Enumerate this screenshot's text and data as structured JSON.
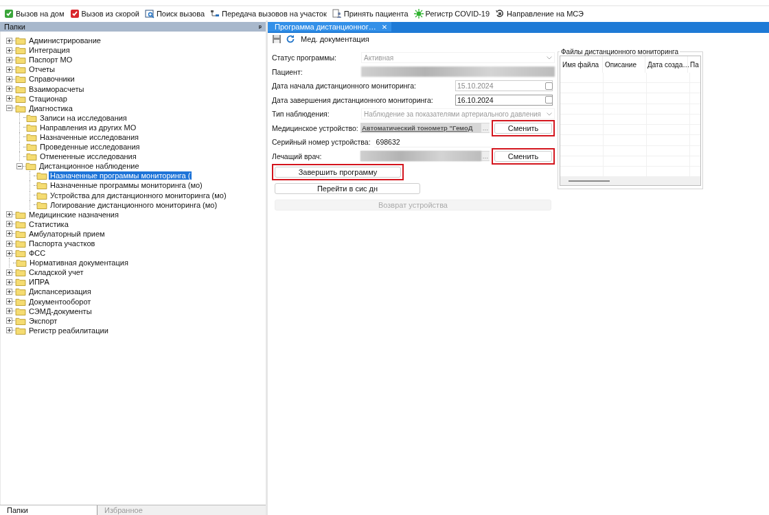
{
  "top_toolbar": [
    {
      "label": "Вызов на дом",
      "kind": "home-call"
    },
    {
      "label": "Вызов из скорой",
      "kind": "ambulance-call"
    },
    {
      "label": "Поиск вызова",
      "kind": "search"
    },
    {
      "label": "Передача вызовов на участок",
      "kind": "transfer"
    },
    {
      "label": "Принять пациента",
      "kind": "accept"
    },
    {
      "label": "Регистр COVID-19",
      "kind": "virus"
    },
    {
      "label": "Направление на МСЭ",
      "kind": "referral"
    }
  ],
  "left_panel": {
    "title": "Папки",
    "pin": "ᵖ",
    "tree": [
      {
        "label": "Администрирование",
        "kind": "group",
        "expanded": false,
        "selected": false
      },
      {
        "label": "Интеграция",
        "kind": "group",
        "expanded": false,
        "selected": false
      },
      {
        "label": "Паспорт МО",
        "kind": "group",
        "expanded": false,
        "selected": false
      },
      {
        "label": "Отчеты",
        "kind": "group",
        "expanded": false,
        "selected": false
      },
      {
        "label": "Справочники",
        "kind": "group",
        "expanded": false,
        "selected": false
      },
      {
        "label": "Взаиморасчеты",
        "kind": "group",
        "expanded": false,
        "selected": false
      },
      {
        "label": "Стационар",
        "kind": "group",
        "expanded": false,
        "selected": false
      },
      {
        "label": "Диагностика",
        "kind": "group",
        "expanded": true,
        "selected": false,
        "children": [
          {
            "label": "Записи на исследования",
            "kind": "leaf",
            "selected": false
          },
          {
            "label": "Направления из других МО",
            "kind": "leaf",
            "selected": false
          },
          {
            "label": "Назначенные исследования",
            "kind": "leaf",
            "selected": false
          },
          {
            "label": "Проведенные исследования",
            "kind": "leaf",
            "selected": false
          },
          {
            "label": "Отмененные исследования",
            "kind": "leaf",
            "selected": false
          },
          {
            "label": "Дистанционное наблюдение",
            "kind": "group",
            "expanded": true,
            "selected": false,
            "children": [
              {
                "label": "Назначенные программы мониторинга (",
                "kind": "leaf",
                "selected": true
              },
              {
                "label": "Назначенные программы мониторинга (мо)",
                "kind": "leaf",
                "selected": false
              },
              {
                "label": "Устройства для дистанционного мониторинга (мо)",
                "kind": "leaf",
                "selected": false
              },
              {
                "label": "Логирование дистанционного мониторинга (мо)",
                "kind": "leaf",
                "selected": false
              }
            ]
          }
        ]
      },
      {
        "label": "Медицинские назначения",
        "kind": "group",
        "expanded": false,
        "selected": false
      },
      {
        "label": "Статистика",
        "kind": "group",
        "expanded": false,
        "selected": false
      },
      {
        "label": "Амбулаторный прием",
        "kind": "group",
        "expanded": false,
        "selected": false
      },
      {
        "label": "Паспорта участков",
        "kind": "group",
        "expanded": false,
        "selected": false
      },
      {
        "label": "ФСС",
        "kind": "group",
        "expanded": false,
        "selected": false
      },
      {
        "label": "Нормативная документация",
        "kind": "leaf",
        "selected": false
      },
      {
        "label": "Складской учет",
        "kind": "group",
        "expanded": false,
        "selected": false
      },
      {
        "label": "ИПРА",
        "kind": "group",
        "expanded": false,
        "selected": false
      },
      {
        "label": "Диспансеризация",
        "kind": "group",
        "expanded": false,
        "selected": false
      },
      {
        "label": "Документооборот",
        "kind": "group",
        "expanded": false,
        "selected": false
      },
      {
        "label": "СЭМД-документы",
        "kind": "group",
        "expanded": false,
        "selected": false
      },
      {
        "label": "Экспорт",
        "kind": "group",
        "expanded": false,
        "selected": false
      },
      {
        "label": "Регистр реабилитации",
        "kind": "group",
        "expanded": false,
        "selected": false
      }
    ],
    "bottom_tabs": [
      {
        "label": "Папки",
        "selected": true
      },
      {
        "label": "Избранное",
        "selected": false
      }
    ]
  },
  "document_tabs": [
    {
      "label": "Программа дистанционног…",
      "selected": true,
      "close": "✕"
    }
  ],
  "doc_toolbar": {
    "label": "Мед. документация"
  },
  "form": {
    "fields": [
      {
        "kind": "select",
        "label": "Статус программы:",
        "value": "Активная",
        "disabled": true
      },
      {
        "kind": "redacted",
        "label": "Пациент:"
      },
      {
        "kind": "date",
        "label": "Дата начала дистанционного мониторинга:",
        "value": "15.10.2024",
        "disabled": true,
        "checked": false
      },
      {
        "kind": "date",
        "label": "Дата завершения дистанционного мониторинга:",
        "value": "16.10.2024",
        "disabled": false,
        "checked": false
      },
      {
        "kind": "select",
        "label": "Тип наблюдения:",
        "value": "Наблюдение за показателями артериального давления",
        "disabled": true
      },
      {
        "kind": "lookup",
        "label": "Медицинское устройство:",
        "value": "Автоматический тонометр \"ГемоД",
        "picker": "…",
        "button": {
          "label": "Сменить",
          "highlighted": true
        }
      },
      {
        "kind": "text",
        "label": "Серийный номер устройства:",
        "value": "698632"
      },
      {
        "kind": "lookup",
        "label": "Лечащий врач:",
        "picker": "…",
        "button": {
          "label": "Сменить",
          "highlighted": true
        }
      }
    ],
    "actions": [
      {
        "label": "Завершить программу",
        "highlighted": true,
        "disabled": false
      },
      {
        "label": "Перейти в сис дн",
        "highlighted": false,
        "disabled": false
      },
      {
        "label": "Возврат устройства",
        "highlighted": false,
        "disabled": true
      }
    ]
  },
  "files": {
    "title": "Файлы дистанционного мониторинга",
    "columns": [
      "Имя файла",
      "Описание",
      "Дата созда…",
      "Па"
    ]
  }
}
